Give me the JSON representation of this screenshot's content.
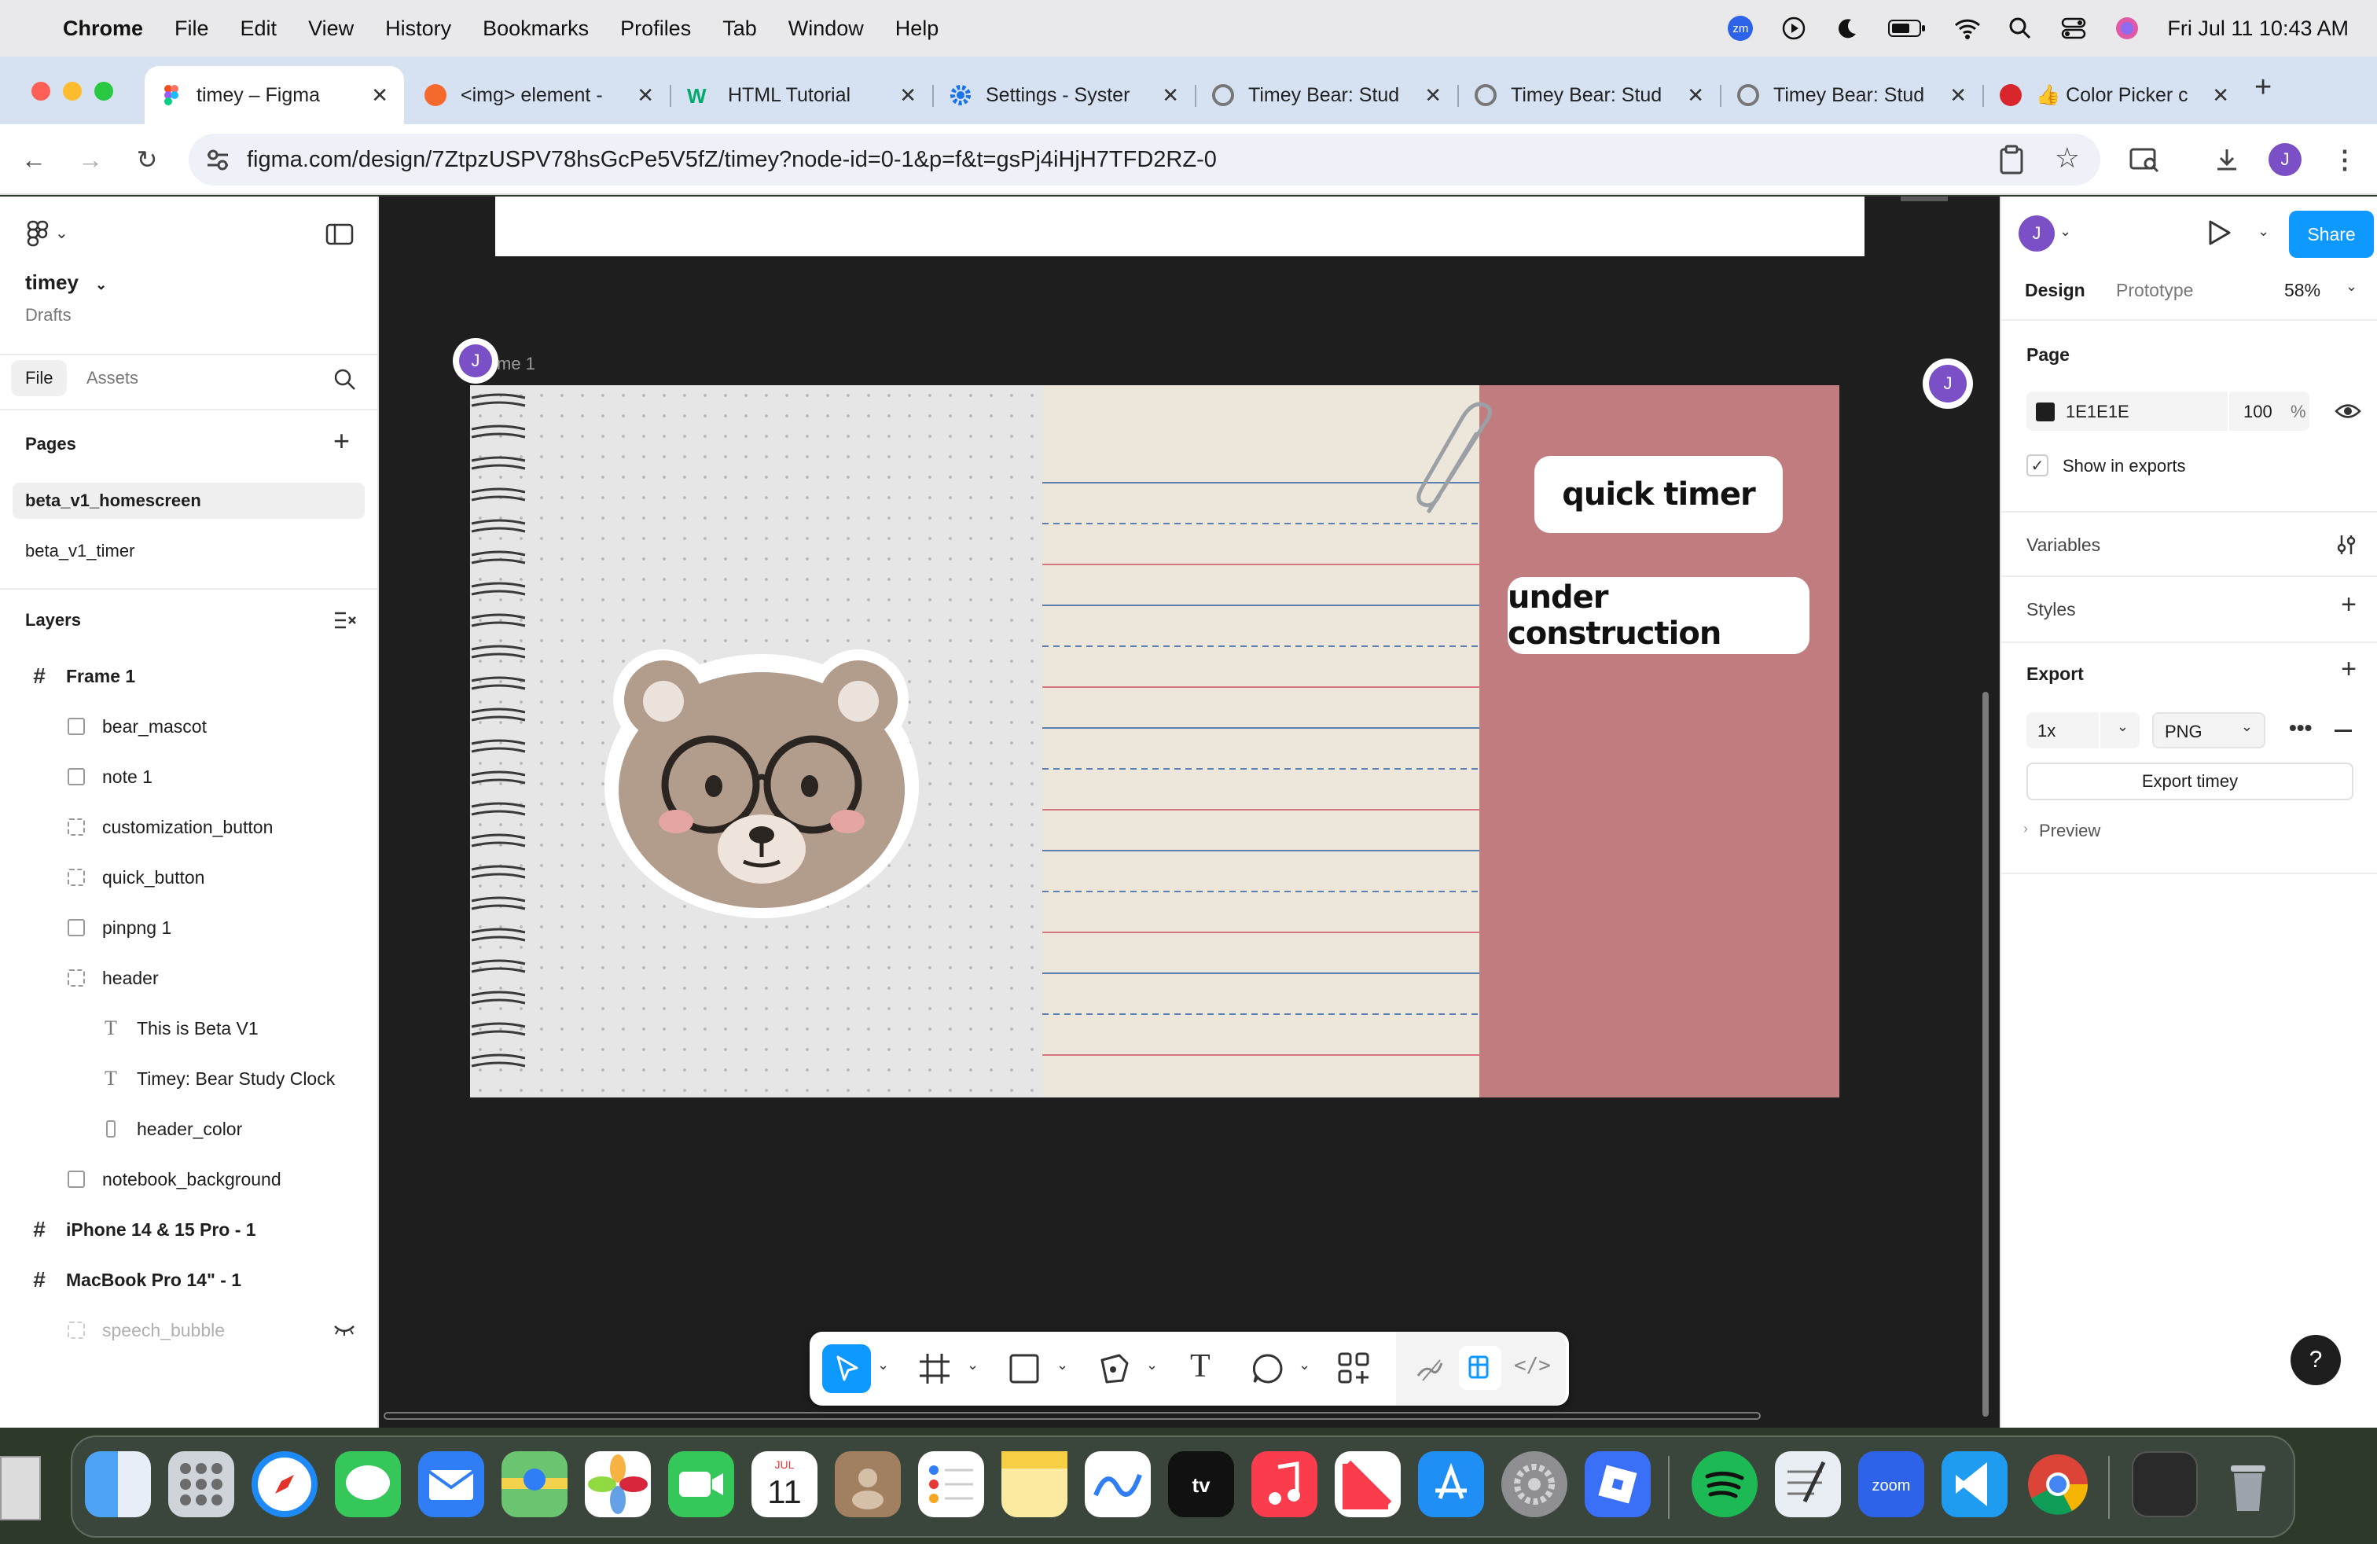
{
  "menubar": {
    "app_name": "Chrome",
    "menus": [
      "File",
      "Edit",
      "View",
      "History",
      "Bookmarks",
      "Profiles",
      "Tab",
      "Window",
      "Help"
    ],
    "zoom_badge": "zm",
    "datetime": "Fri Jul 11  10:43 AM"
  },
  "tabs": [
    {
      "label": "timey – Figma",
      "active": true
    },
    {
      "label": "<img> element -"
    },
    {
      "label": "HTML Tutorial"
    },
    {
      "label": "Settings - Syster"
    },
    {
      "label": "Timey Bear: Stud"
    },
    {
      "label": "Timey Bear: Stud"
    },
    {
      "label": "Timey Bear: Stud"
    },
    {
      "label": "👍 Color Picker c"
    }
  ],
  "address": {
    "url": "figma.com/design/7ZtpzUSPV78hsGcPe5V5fZ/timey?node-id=0-1&p=f&t=gsPj4iHjH7TFD2RZ-0",
    "avatar_letter": "J"
  },
  "left": {
    "file_name": "timey",
    "file_location": "Drafts",
    "tabs": [
      "File",
      "Assets"
    ],
    "pages_title": "Pages",
    "pages": [
      "beta_v1_homescreen",
      "beta_v1_timer"
    ],
    "layers_title": "Layers",
    "layers": [
      {
        "name": "Frame 1",
        "kind": "frame",
        "depth": 0
      },
      {
        "name": "bear_mascot",
        "kind": "image",
        "depth": 1
      },
      {
        "name": "note 1",
        "kind": "image",
        "depth": 1
      },
      {
        "name": "customization_button",
        "kind": "group",
        "depth": 1
      },
      {
        "name": "quick_button",
        "kind": "group",
        "depth": 1
      },
      {
        "name": "pinpng 1",
        "kind": "image",
        "depth": 1
      },
      {
        "name": "header",
        "kind": "group",
        "depth": 1
      },
      {
        "name": "This is Beta V1",
        "kind": "text",
        "depth": 2
      },
      {
        "name": "Timey: Bear Study Clock",
        "kind": "text",
        "depth": 2
      },
      {
        "name": "header_color",
        "kind": "rect",
        "depth": 2
      },
      {
        "name": "notebook_background",
        "kind": "image",
        "depth": 1
      },
      {
        "name": "iPhone 14 & 15 Pro - 1",
        "kind": "frame",
        "depth": 0
      },
      {
        "name": "MacBook Pro 14\" - 1",
        "kind": "frame",
        "depth": 0
      },
      {
        "name": "speech_bubble",
        "kind": "hidden",
        "depth": 1
      }
    ]
  },
  "canvas": {
    "frame_label": "me 1",
    "avatar_letter": "J",
    "quick_timer_label": "quick timer",
    "construction_label": "under construction"
  },
  "right": {
    "avatar_letter": "J",
    "share_label": "Share",
    "tabs": [
      "Design",
      "Prototype"
    ],
    "zoom": "58%",
    "page_title": "Page",
    "page_color_hex": "1E1E1E",
    "page_opacity": "100",
    "percent_sign": "%",
    "show_in_exports": "Show in exports",
    "variables": "Variables",
    "styles": "Styles",
    "export": "Export",
    "export_scale": "1x",
    "export_format": "PNG",
    "export_button": "Export timey",
    "preview": "Preview",
    "help": "?"
  },
  "colors": {
    "figma_blue": "#0d99ff",
    "avatar_purple": "#7b4fc6",
    "canvas_bg": "#1e1e1e",
    "pink_panel": "#c17c80"
  }
}
